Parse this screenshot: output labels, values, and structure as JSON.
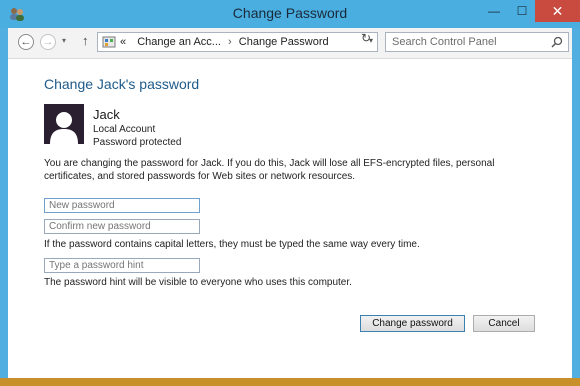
{
  "window": {
    "title": "Change Password",
    "minimize_glyph": "—",
    "maximize_glyph": "☐",
    "close_glyph": "✕"
  },
  "nav": {
    "back_glyph": "←",
    "forward_glyph": "→",
    "recent_glyph": "▾",
    "up_glyph": "↑",
    "breadcrumb_prefix": "«",
    "breadcrumb_1": "Change an Acc...",
    "breadcrumb_sep": "›",
    "breadcrumb_2": "Change Password",
    "address_drop_glyph": "▾",
    "refresh_glyph": "↻",
    "search_placeholder": "Search Control Panel"
  },
  "main": {
    "heading": "Change Jack's password",
    "user_name": "Jack",
    "account_type": "Local Account",
    "protection": "Password protected",
    "warning": "You are changing the password for Jack.  If you do this, Jack will lose all EFS-encrypted files, personal certificates, and stored passwords for Web sites or network resources.",
    "new_password_placeholder": "New password",
    "confirm_password_placeholder": "Confirm new password",
    "caps_note": "If the password contains capital letters, they must be typed the same way every time.",
    "hint_placeholder": "Type a password hint",
    "hint_note": "The password hint will be visible to everyone who uses this computer.",
    "change_button": "Change password",
    "cancel_button": "Cancel"
  },
  "colors": {
    "titlebar": "#4aaee0",
    "close": "#c94a3e",
    "heading": "#1e5b8a",
    "avatar_bg": "#2a1f30"
  },
  "icons": {
    "app": "user-accounts-icon",
    "address": "control-panel-icon",
    "search": "search-icon",
    "avatar": "user-silhouette-icon"
  }
}
